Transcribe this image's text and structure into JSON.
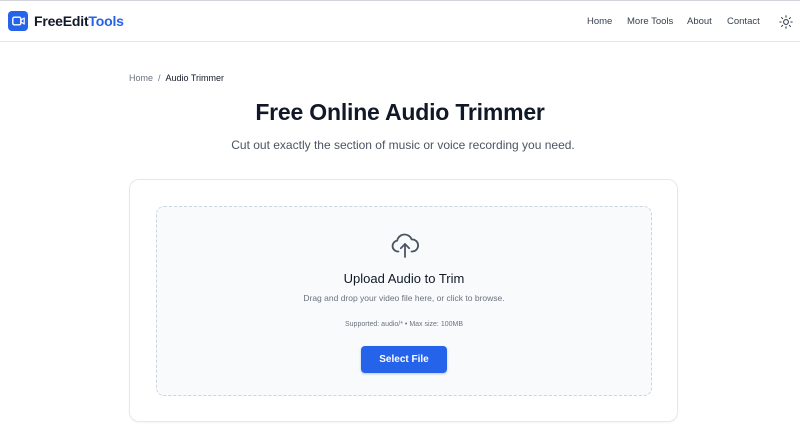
{
  "brand": {
    "name_part1": "FreeEdit",
    "name_part2": "Tools",
    "logo_icon": "video-camera-icon"
  },
  "nav": {
    "items": [
      "Home",
      "More Tools",
      "About",
      "Contact"
    ],
    "theme_toggle_icon": "sun-icon"
  },
  "breadcrumb": {
    "home": "Home",
    "separator": "/",
    "current": "Audio Trimmer"
  },
  "page": {
    "title": "Free Online Audio Trimmer",
    "subtitle": "Cut out exactly the section of music or voice recording you need."
  },
  "upload": {
    "icon": "cloud-upload-icon",
    "title": "Upload Audio to Trim",
    "description": "Drag and drop your video file here, or click to browse.",
    "supported": "Supported: audio/* • Max size: 100MB",
    "button_label": "Select File"
  },
  "colors": {
    "accent": "#2563eb",
    "text": "#111827",
    "muted": "#6b7280",
    "dropzone_bg": "#f8fafc",
    "border": "#e5e7eb"
  }
}
